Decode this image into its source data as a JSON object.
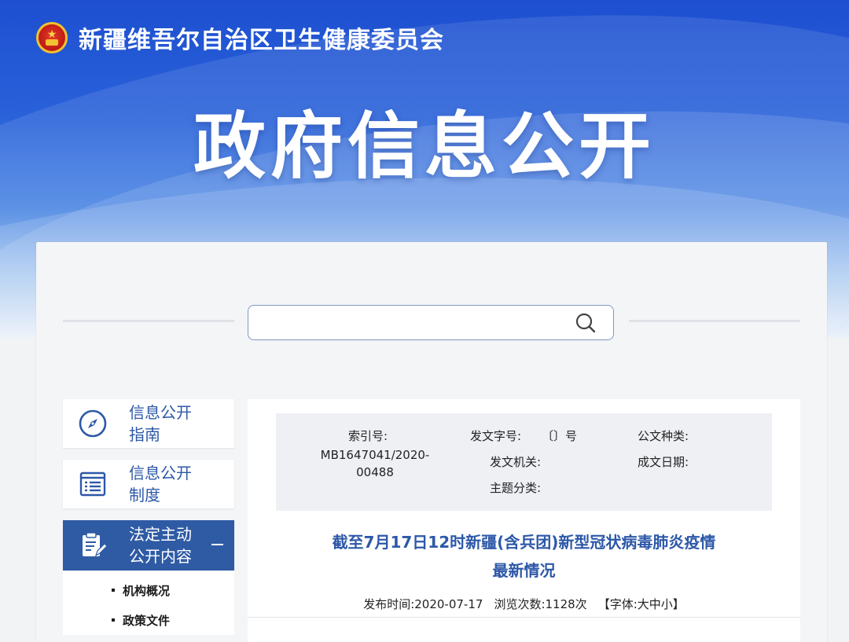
{
  "header": {
    "org_name": "新疆维吾尔自治区卫生健康委员会",
    "hero_title": "政府信息公开"
  },
  "search": {
    "value": "",
    "placeholder": ""
  },
  "sidebar": {
    "items": [
      {
        "label_line1": "信息公开",
        "label_line2": "指南",
        "icon": "compass-icon"
      },
      {
        "label_line1": "信息公开",
        "label_line2": "制度",
        "icon": "list-document-icon"
      },
      {
        "label_line1": "法定主动",
        "label_line2": "公开内容",
        "icon": "edit-document-icon",
        "active": true
      }
    ],
    "subitems": [
      "机构概况",
      "政策文件"
    ]
  },
  "document": {
    "meta": {
      "index_label": "索引号:",
      "index_value_line1": "MB1647041/2020-",
      "index_value_line2": "00488",
      "doc_number_label": "发文字号:",
      "doc_number_value": "〔〕号",
      "issuer_label": "发文机关:",
      "topic_label": "主题分类:",
      "doc_type_label": "公文种类:",
      "date_label": "成文日期:"
    },
    "title_line1": "截至7月17日12时新疆(含兵团)新型冠状病毒肺炎疫情",
    "title_line2": "最新情况",
    "publish_label": "发布时间:",
    "publish_date": "2020-07-17",
    "views_label": "浏览次数:",
    "views_count": "1128次",
    "font_label_open": "【字体:",
    "font_large": "大",
    "font_medium": "中",
    "font_small": "小",
    "font_label_close": "】"
  },
  "colors": {
    "accent": "#2d58a8",
    "banner": "#1d4fd0",
    "active_bg": "#2f5ba5"
  }
}
